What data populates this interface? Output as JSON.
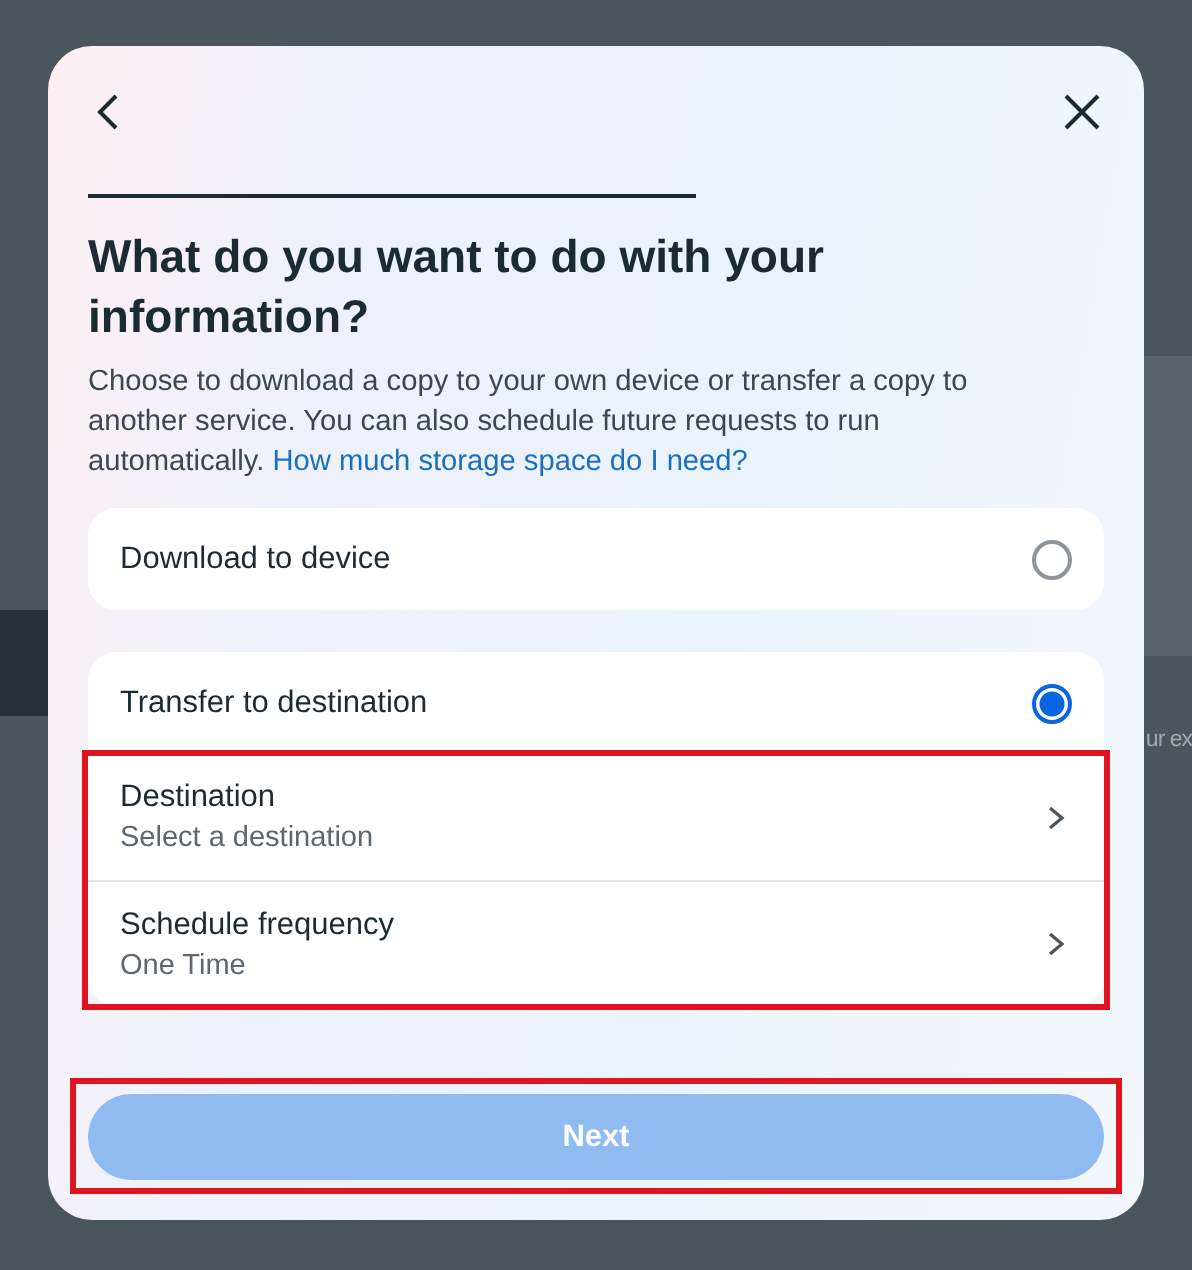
{
  "background": {
    "side_text": "ur ex"
  },
  "dialog": {
    "heading": "What do you want to do with your information?",
    "description": "Choose to download a copy to your own device or transfer a copy to another service. You can also schedule future requests to run automatically.",
    "link": "How much storage space do I need?",
    "options": [
      {
        "label": "Download to device",
        "selected": false
      },
      {
        "label": "Transfer to destination",
        "selected": true,
        "settings": [
          {
            "title": "Destination",
            "value": "Select a destination"
          },
          {
            "title": "Schedule frequency",
            "value": "One Time"
          }
        ]
      }
    ],
    "next_button": {
      "label": "Next",
      "disabled": true
    }
  }
}
